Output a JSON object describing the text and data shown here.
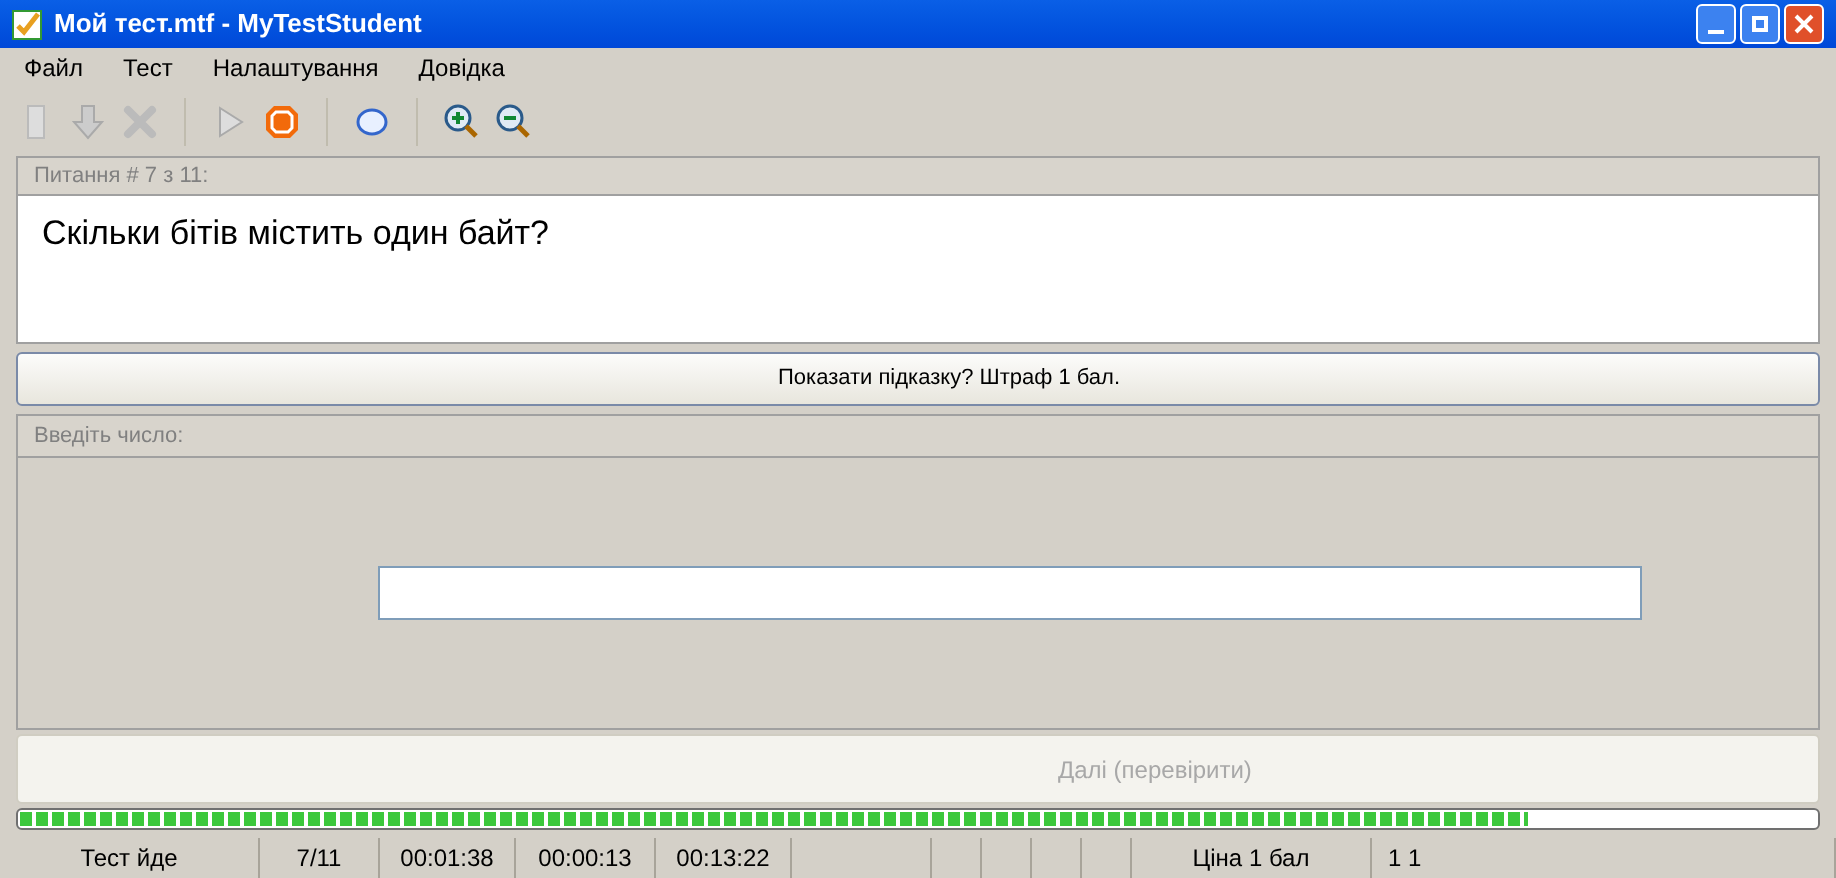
{
  "window": {
    "title": "Мой тест.mtf - MyTestStudent"
  },
  "menu": [
    "Файл",
    "Тест",
    "Налаштування",
    "Довідка"
  ],
  "toolbar": [
    {
      "kind": "exit",
      "disabled": true
    },
    {
      "kind": "down",
      "disabled": true
    },
    {
      "kind": "cancel",
      "disabled": true
    },
    {
      "kind": "separator"
    },
    {
      "kind": "play",
      "disabled": true
    },
    {
      "kind": "stop",
      "disabled": false
    },
    {
      "kind": "separator"
    },
    {
      "kind": "comment",
      "disabled": false
    },
    {
      "kind": "separator"
    },
    {
      "kind": "zoom-in",
      "disabled": false
    },
    {
      "kind": "zoom-out",
      "disabled": false
    }
  ],
  "question": {
    "header": "Питання # 7 з 11:",
    "text": "Скільки бітів містить один байт?"
  },
  "hint_button": {
    "label": "Показати підказку? Штраф 1 бал.",
    "disabled": false
  },
  "answer": {
    "header": "Введіть число:"
  },
  "next_button": {
    "label": "Далі (перевірити)",
    "disabled": true
  },
  "progress": {
    "level": 0.84
  },
  "status_bar": [
    "Тест йде",
    "7/11",
    "00:01:38",
    "00:00:13",
    "00:13:22",
    "Ціна 1 бал",
    "1 1"
  ]
}
